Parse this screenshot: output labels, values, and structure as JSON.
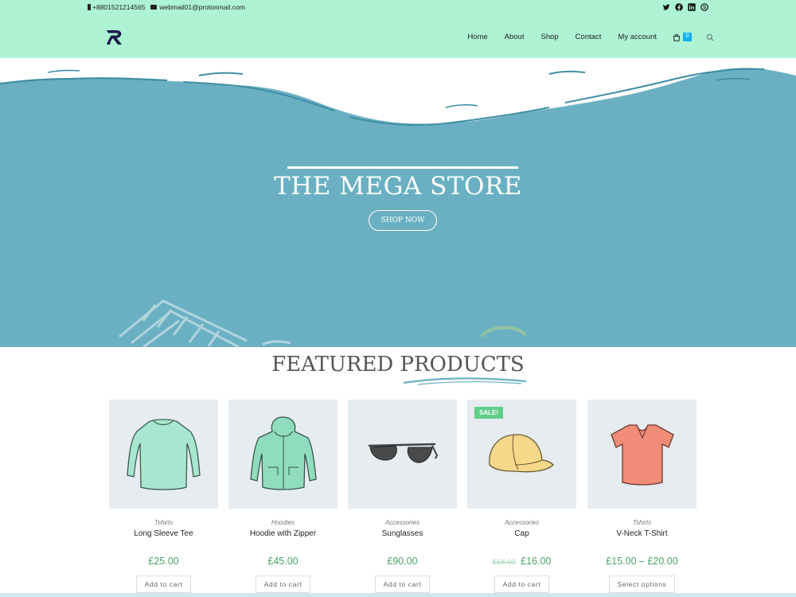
{
  "colors": {
    "header_bg": "#adf3d4",
    "hero_bg": "#6ab0c2",
    "price_green": "#4aa56a",
    "sale_badge": "#5fcf8a",
    "cart_badge": "#13aff0"
  },
  "topbar": {
    "phone": "+8801521214565",
    "email": "webmail01@protonmail.com",
    "phone_icon": "phone-icon",
    "email_icon": "envelope-icon",
    "socials": [
      "twitter-icon",
      "facebook-icon",
      "linkedin-icon",
      "skype-icon"
    ]
  },
  "nav": {
    "items": [
      "Home",
      "About",
      "Shop",
      "Contact",
      "My account"
    ],
    "cart_count": "0",
    "cart_icon": "shopping-bag-icon",
    "search_icon": "search-icon"
  },
  "hero": {
    "title": "THE MEGA STORE",
    "button": "SHOP NOW"
  },
  "featured": {
    "title": "FEATURED PRODUCTS",
    "products": [
      {
        "category": "Tshirts",
        "name": "Long Sleeve Tee",
        "price": "£25.00",
        "old_price": "",
        "button": "Add to cart",
        "sale": ""
      },
      {
        "category": "Hoodies",
        "name": "Hoodie with Zipper",
        "price": "£45.00",
        "old_price": "",
        "button": "Add to cart",
        "sale": ""
      },
      {
        "category": "Accessories",
        "name": "Sunglasses",
        "price": "£90.00",
        "old_price": "",
        "button": "Add to cart",
        "sale": ""
      },
      {
        "category": "Accessories",
        "name": "Cap",
        "price": "£16.00",
        "old_price": "£18.00",
        "button": "Add to cart",
        "sale": "SALE!"
      },
      {
        "category": "Tshirts",
        "name": "V-Neck T-Shirt",
        "price": "£15.00 – £20.00",
        "old_price": "",
        "button": "Select options",
        "sale": ""
      }
    ]
  }
}
